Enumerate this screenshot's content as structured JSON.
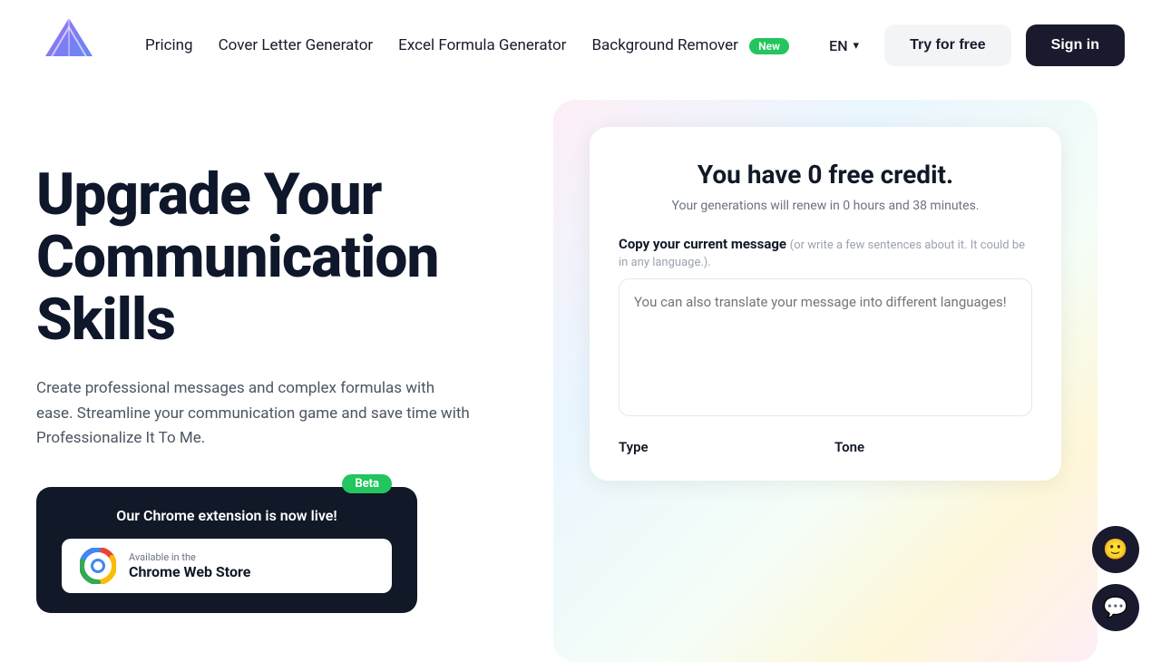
{
  "nav": {
    "logo_alt": "Professionalize It To Me Logo",
    "links": [
      {
        "label": "Pricing",
        "badge": null
      },
      {
        "label": "Cover Letter Generator",
        "badge": null
      },
      {
        "label": "Excel Formula Generator",
        "badge": null
      },
      {
        "label": "Background Remover",
        "badge": "New"
      }
    ],
    "lang": "EN",
    "try_free": "Try for free",
    "sign_in": "Sign in"
  },
  "hero": {
    "headline_line1": "Upgrade Your",
    "headline_line2": "Communication",
    "headline_line3": "Skills",
    "subtext": "Create professional messages and complex formulas with ease. Streamline your communication game and save time with Professionalize It To Me.",
    "chrome_card": {
      "beta_badge": "Beta",
      "title": "Our Chrome extension is now live!",
      "badge_small": "Available in the",
      "badge_big": "Chrome Web Store"
    }
  },
  "card": {
    "credit_title": "You have 0 free credit.",
    "renew_text": "Your generations will renew in 0 hours and 38 minutes.",
    "copy_label": "Copy your current message",
    "copy_sublabel": "(or write a few sentences about it. It could be in any language.).",
    "textarea_placeholder": "You can also translate your message into different languages!",
    "type_label": "Type",
    "tone_label": "Tone"
  },
  "chat": {
    "icon1": "😊",
    "icon2": "💬"
  }
}
